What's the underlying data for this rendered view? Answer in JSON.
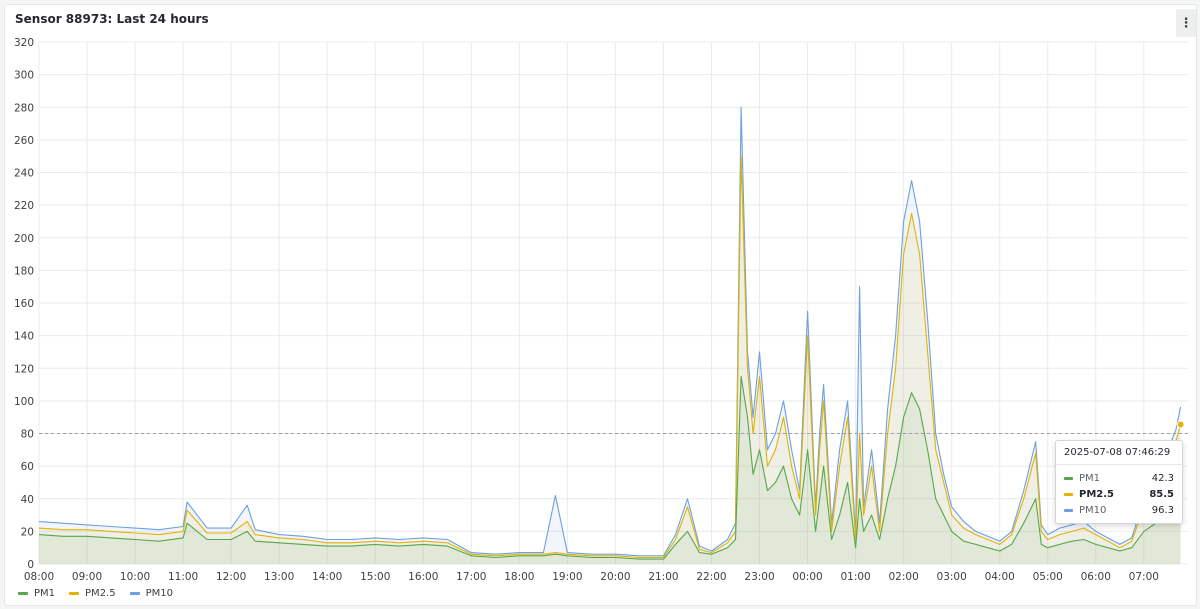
{
  "panel": {
    "title": "Sensor 88973: Last 24 hours"
  },
  "tooltip": {
    "time": "2025-07-08 07:46:29",
    "rows": [
      {
        "name": "PM1",
        "value": "42.3",
        "color": "#56a64b"
      },
      {
        "name": "PM2.5",
        "value": "85.5",
        "color": "#e0b400"
      },
      {
        "name": "PM10",
        "value": "96.3",
        "color": "#6e9fde"
      }
    ]
  },
  "legend": [
    {
      "name": "PM1",
      "color": "#56a64b"
    },
    {
      "name": "PM2.5",
      "color": "#e0b400"
    },
    {
      "name": "PM10",
      "color": "#6e9fde"
    }
  ],
  "chart_data": {
    "type": "area",
    "title": "Sensor 88973: Last 24 hours",
    "xlabel": "",
    "ylabel": "",
    "ylim": [
      0,
      320
    ],
    "yticks": [
      0,
      20,
      40,
      60,
      80,
      100,
      120,
      140,
      160,
      180,
      200,
      220,
      240,
      260,
      280,
      300,
      320
    ],
    "xlim": [
      0,
      23.92
    ],
    "xticks": [
      "08:00",
      "09:00",
      "10:00",
      "11:00",
      "12:00",
      "13:00",
      "14:00",
      "15:00",
      "16:00",
      "17:00",
      "18:00",
      "19:00",
      "20:00",
      "21:00",
      "22:00",
      "23:00",
      "00:00",
      "01:00",
      "02:00",
      "03:00",
      "04:00",
      "05:00",
      "06:00",
      "07:00"
    ],
    "grid": true,
    "legend_position": "bottom-left",
    "crosshair_y": 80,
    "x": [
      "08:00",
      "08:30",
      "09:00",
      "09:30",
      "10:00",
      "10:30",
      "11:00",
      "11:05",
      "11:30",
      "12:00",
      "12:30",
      "12:20",
      "13:00",
      "13:30",
      "14:00",
      "14:30",
      "15:00",
      "15:30",
      "16:00",
      "16:30",
      "17:00",
      "17:30",
      "18:00",
      "18:30",
      "18:45",
      "19:00",
      "19:30",
      "20:00",
      "20:30",
      "21:00",
      "21:15",
      "21:30",
      "21:45",
      "22:00",
      "22:20",
      "22:30",
      "22:37",
      "22:45",
      "22:52",
      "23:00",
      "23:10",
      "23:20",
      "23:30",
      "23:40",
      "23:50",
      "00:00",
      "00:10",
      "00:15",
      "00:20",
      "00:30",
      "00:40",
      "00:50",
      "01:00",
      "01:05",
      "01:10",
      "01:20",
      "01:30",
      "01:40",
      "01:50",
      "02:00",
      "02:10",
      "02:20",
      "02:30",
      "02:40",
      "02:50",
      "03:00",
      "03:15",
      "03:30",
      "03:45",
      "04:00",
      "04:15",
      "04:30",
      "04:45",
      "04:52",
      "05:00",
      "05:15",
      "05:30",
      "05:45",
      "06:00",
      "06:15",
      "06:30",
      "06:45",
      "07:00",
      "07:15",
      "07:30",
      "07:40",
      "07:46"
    ],
    "series": [
      {
        "name": "PM1",
        "color": "#56a64b",
        "values": [
          18,
          17,
          17,
          16,
          15,
          14,
          16,
          25,
          15,
          15,
          14,
          20,
          13,
          12,
          11,
          11,
          12,
          11,
          12,
          11,
          5,
          4,
          5,
          5,
          6,
          5,
          4,
          4,
          3,
          3,
          12,
          20,
          7,
          6,
          10,
          15,
          115,
          90,
          55,
          70,
          45,
          50,
          60,
          40,
          30,
          70,
          20,
          40,
          60,
          15,
          30,
          50,
          10,
          40,
          20,
          30,
          15,
          40,
          60,
          90,
          105,
          95,
          70,
          40,
          30,
          20,
          14,
          12,
          10,
          8,
          12,
          25,
          40,
          12,
          10,
          12,
          14,
          15,
          12,
          10,
          8,
          10,
          20,
          25,
          32,
          38,
          42
        ]
      },
      {
        "name": "PM2.5",
        "color": "#e0b400",
        "values": [
          22,
          21,
          21,
          20,
          19,
          18,
          20,
          33,
          19,
          19,
          18,
          26,
          16,
          15,
          13,
          13,
          14,
          13,
          14,
          13,
          6,
          5,
          6,
          6,
          7,
          6,
          5,
          5,
          4,
          4,
          15,
          35,
          9,
          7,
          13,
          20,
          250,
          120,
          80,
          115,
          60,
          70,
          90,
          60,
          40,
          140,
          30,
          70,
          100,
          20,
          60,
          90,
          15,
          80,
          30,
          60,
          20,
          80,
          120,
          190,
          215,
          190,
          130,
          70,
          50,
          30,
          22,
          18,
          15,
          12,
          18,
          40,
          68,
          20,
          15,
          18,
          20,
          22,
          18,
          14,
          10,
          14,
          35,
          45,
          60,
          75,
          85.5
        ]
      },
      {
        "name": "PM10",
        "color": "#6e9fde",
        "values": [
          26,
          25,
          24,
          23,
          22,
          21,
          23,
          38,
          22,
          22,
          21,
          36,
          18,
          17,
          15,
          15,
          16,
          15,
          16,
          15,
          7,
          6,
          7,
          7,
          42,
          7,
          6,
          6,
          5,
          5,
          18,
          40,
          11,
          8,
          15,
          25,
          280,
          130,
          90,
          130,
          70,
          80,
          100,
          70,
          45,
          155,
          35,
          80,
          110,
          25,
          70,
          100,
          18,
          170,
          35,
          70,
          25,
          95,
          140,
          210,
          235,
          210,
          150,
          80,
          55,
          35,
          26,
          20,
          17,
          14,
          20,
          45,
          75,
          24,
          18,
          22,
          24,
          26,
          20,
          16,
          12,
          16,
          40,
          55,
          70,
          82,
          96.3
        ]
      }
    ]
  }
}
